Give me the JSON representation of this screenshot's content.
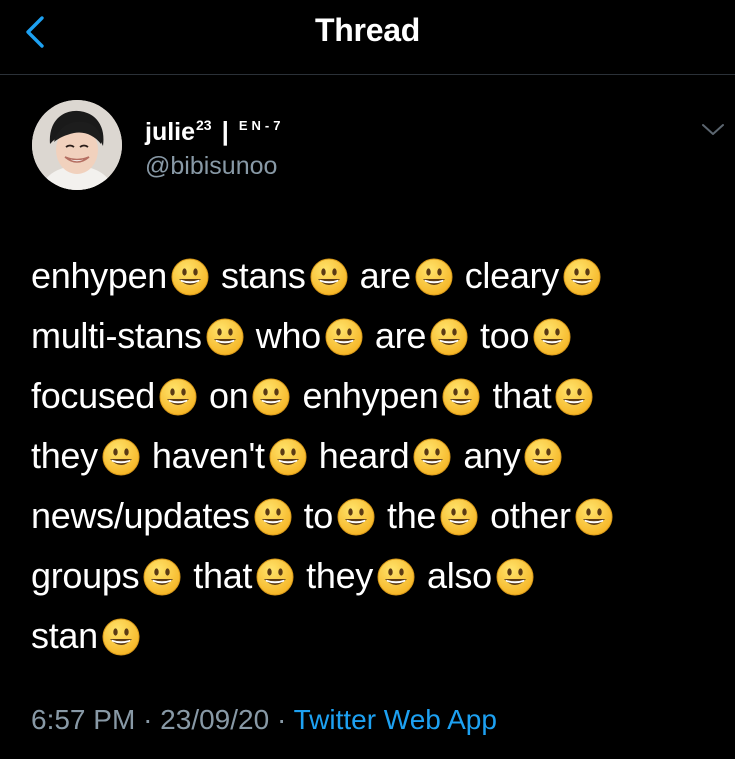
{
  "header": {
    "title": "Thread",
    "back_icon": "chevron-left-icon",
    "accent": "#1da1f2"
  },
  "tweet": {
    "author": {
      "display_name": "julie",
      "superscript": "23",
      "separator": "|",
      "tag": "EN-7",
      "handle": "@bibisunoo",
      "avatar_icon": "avatar-photo"
    },
    "menu_icon": "chevron-down-icon",
    "emoji": "grinning-face",
    "lines": [
      [
        "enhypen",
        "stans",
        "are",
        "cleary"
      ],
      [
        "multi-stans",
        "who",
        "are",
        "too"
      ],
      [
        "focused",
        "on",
        "enhypen",
        "that"
      ],
      [
        "they",
        "haven't",
        "heard",
        "any"
      ],
      [
        "news/updates",
        "to",
        "the",
        "other"
      ],
      [
        "groups",
        "that",
        "they",
        "also"
      ],
      [
        "stan"
      ]
    ],
    "time": "6:57 PM",
    "dot": "·",
    "date": "23/09/20",
    "source": "Twitter Web App"
  }
}
